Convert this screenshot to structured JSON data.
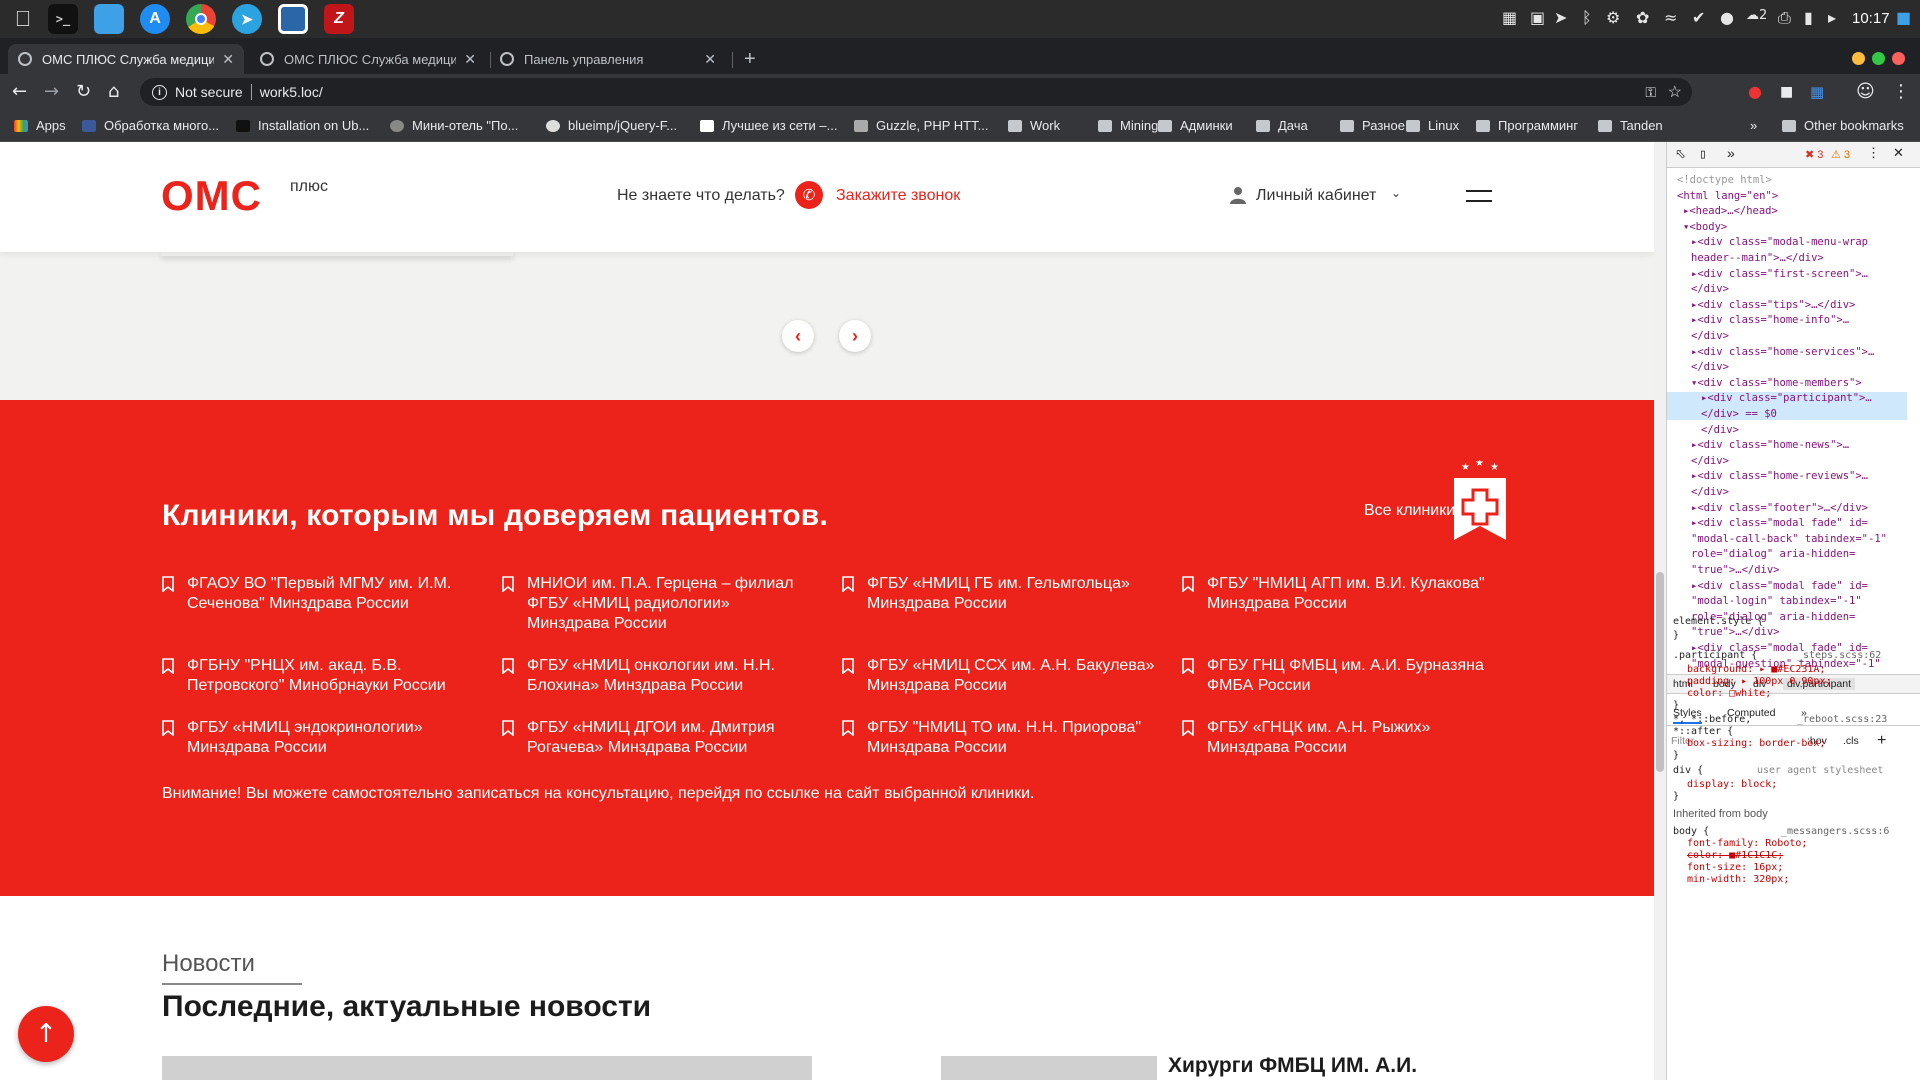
{
  "system": {
    "clock": "10:17",
    "tray_badge": "2"
  },
  "tabs": [
    {
      "title": "ОМС ПЛЮС Служба медици",
      "active": true
    },
    {
      "title": "ОМС ПЛЮС Служба медици",
      "active": false
    },
    {
      "title": "Панель управления",
      "active": false
    }
  ],
  "address": {
    "security": "Not secure",
    "url": "work5.loc/"
  },
  "bookmarks": [
    "Apps",
    "Обработка много...",
    "Installation on Ub...",
    "Мини-отель \"По...",
    "blueimp/jQuery-F...",
    "Лучшее из сети –...",
    "Guzzle, PHP HTT...",
    "Work",
    "Mining",
    "Админки",
    "Дача",
    "Разное",
    "Linux",
    "Программинг",
    "Tanden",
    "Other bookmarks"
  ],
  "site": {
    "logo": "ОМС",
    "logo_suffix": "плюс",
    "hint": "Не знаете что делать?",
    "call_label": "Закажите звонок",
    "cabinet_label": "Личный кабинет",
    "prev": "‹",
    "next": "›"
  },
  "participant": {
    "title": "Клиники, которым мы доверяем пациентов.",
    "all_label": "Все клиники",
    "clinics": [
      {
        "line1": "ФГАОУ ВО \"Первый МГМУ им. И.М.",
        "line2": "Сеченова\" Минздрава России",
        "line3": ""
      },
      {
        "line1": "МНИОИ им. П.А. Герцена – филиал",
        "line2": "ФГБУ «НМИЦ радиологии»",
        "line3": "Минздрава России"
      },
      {
        "line1": "ФГБУ «НМИЦ ГБ им. Гельмгольца»",
        "line2": "Минздрава России",
        "line3": ""
      },
      {
        "line1": "ФГБУ \"НМИЦ АГП им. В.И. Кулакова\"",
        "line2": "Минздрава России",
        "line3": ""
      },
      {
        "line1": "ФГБНУ \"РНЦХ им. акад. Б.В.",
        "line2": "Петровского\" Минобрнауки России",
        "line3": ""
      },
      {
        "line1": "ФГБУ «НМИЦ онкологии им. Н.Н.",
        "line2": "Блохина» Минздрава России",
        "line3": ""
      },
      {
        "line1": "ФГБУ «НМИЦ ССХ им. А.Н. Бакулева»",
        "line2": "Минздрава России",
        "line3": ""
      },
      {
        "line1": "ФГБУ ГНЦ ФМБЦ им. А.И. Бурназяна",
        "line2": "ФМБА России",
        "line3": ""
      },
      {
        "line1": "ФГБУ «НМИЦ эндокринологии»",
        "line2": "Минздрава России",
        "line3": ""
      },
      {
        "line1": "ФГБУ «НМИЦ ДГОИ им. Дмитрия",
        "line2": "Рогачева» Минздрава России",
        "line3": ""
      },
      {
        "line1": "ФГБУ \"НМИЦ ТО им. Н.Н. Приорова\"",
        "line2": "Минздрава России",
        "line3": ""
      },
      {
        "line1": "ФГБУ «ГНЦК им. А.Н. Рыжих»",
        "line2": "Минздрава России",
        "line3": ""
      }
    ],
    "notice": "Внимание! Вы можете самостоятельно записаться на консультацию, перейдя по ссылке на сайт выбранной клиники."
  },
  "news": {
    "subtitle": "Новости",
    "title": "Последние, актуальные новости",
    "headline": "Хирурги ФМБЦ ИМ. А.И."
  },
  "devtools": {
    "errors": "3",
    "warnings": "3",
    "dom_lines": [
      "<!doctype html>",
      "<html lang=\"en\">",
      "▸<head>…</head>",
      "▾<body>",
      "▸<div class=\"modal-menu-wrap",
      "header--main\">…</div>",
      "▸<div class=\"first-screen\">…",
      "</div>",
      "▸<div class=\"tips\">…</div>",
      "▸<div class=\"home-info\">…",
      "</div>",
      "▸<div class=\"home-services\">…",
      "</div>",
      "▾<div class=\"home-members\">",
      "▸<div class=\"participant\">…",
      "</div> == $0",
      "</div>",
      "▸<div class=\"home-news\">…",
      "</div>",
      "▸<div class=\"home-reviews\">…",
      "</div>",
      "▸<div class=\"footer\">…</div>",
      "▸<div class=\"modal fade\" id=",
      "\"modal-call-back\" tabindex=\"-1\"",
      "role=\"dialog\" aria-hidden=",
      "\"true\">…</div>",
      "▸<div class=\"modal fade\" id=",
      "\"modal-login\" tabindex=\"-1\"",
      "role=\"dialog\" aria-hidden=",
      "\"true\">…</div>",
      "▸<div class=\"modal fade\" id=",
      "\"modal-question\" tabindex=\"-1\""
    ],
    "breadcrumbs": [
      "html",
      "body",
      "div",
      "div.participant"
    ],
    "tabs": [
      "Styles",
      "Computed",
      "»"
    ],
    "filter_placeholder": "Filter",
    "hov": ":hov",
    "cls": ".cls",
    "styles": [
      "element.style {",
      "}",
      ".participant {",
      "_steps.scss:62",
      "background: ▸ ■#EC231A;",
      "padding: ▸ 100px 0 90px;",
      "color: □white;",
      "}",
      "*, *::before,",
      "_reboot.scss:23",
      "*::after {",
      "box-sizing: border-box;",
      "}",
      "div {",
      "user agent stylesheet",
      "display: block;",
      "}",
      "Inherited from body",
      "body {",
      "_messangers.scss:6",
      "font-family: Roboto;",
      "color: ■#1C1C1C;",
      "font-size: 16px;",
      "min-width: 320px;"
    ]
  },
  "colors": {
    "brand_red": "#EC231A",
    "text_dark": "#1C1C1C"
  }
}
